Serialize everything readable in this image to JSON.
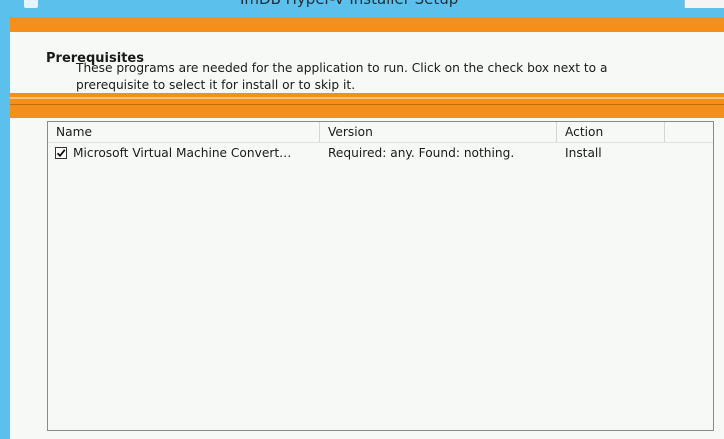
{
  "window": {
    "title": "ImDB Hyper-V Installer Setup"
  },
  "header": {
    "title": "Prerequisites",
    "description": "These programs are needed for the application to run. Click on the check box next to a prerequisite to select it for install or to skip it."
  },
  "list": {
    "columns": [
      "Name",
      "Version",
      "Action"
    ],
    "rows": [
      {
        "checked": true,
        "name": "Microsoft Virtual Machine Convert…",
        "version": "Required: any. Found: nothing.",
        "action": "Install"
      }
    ]
  },
  "colors": {
    "accent_blue": "#5bc0eb",
    "accent_orange": "#f38f1a",
    "panel_bg": "#f7f9f7"
  },
  "icons": [
    "checkbox-checked-icon"
  ]
}
